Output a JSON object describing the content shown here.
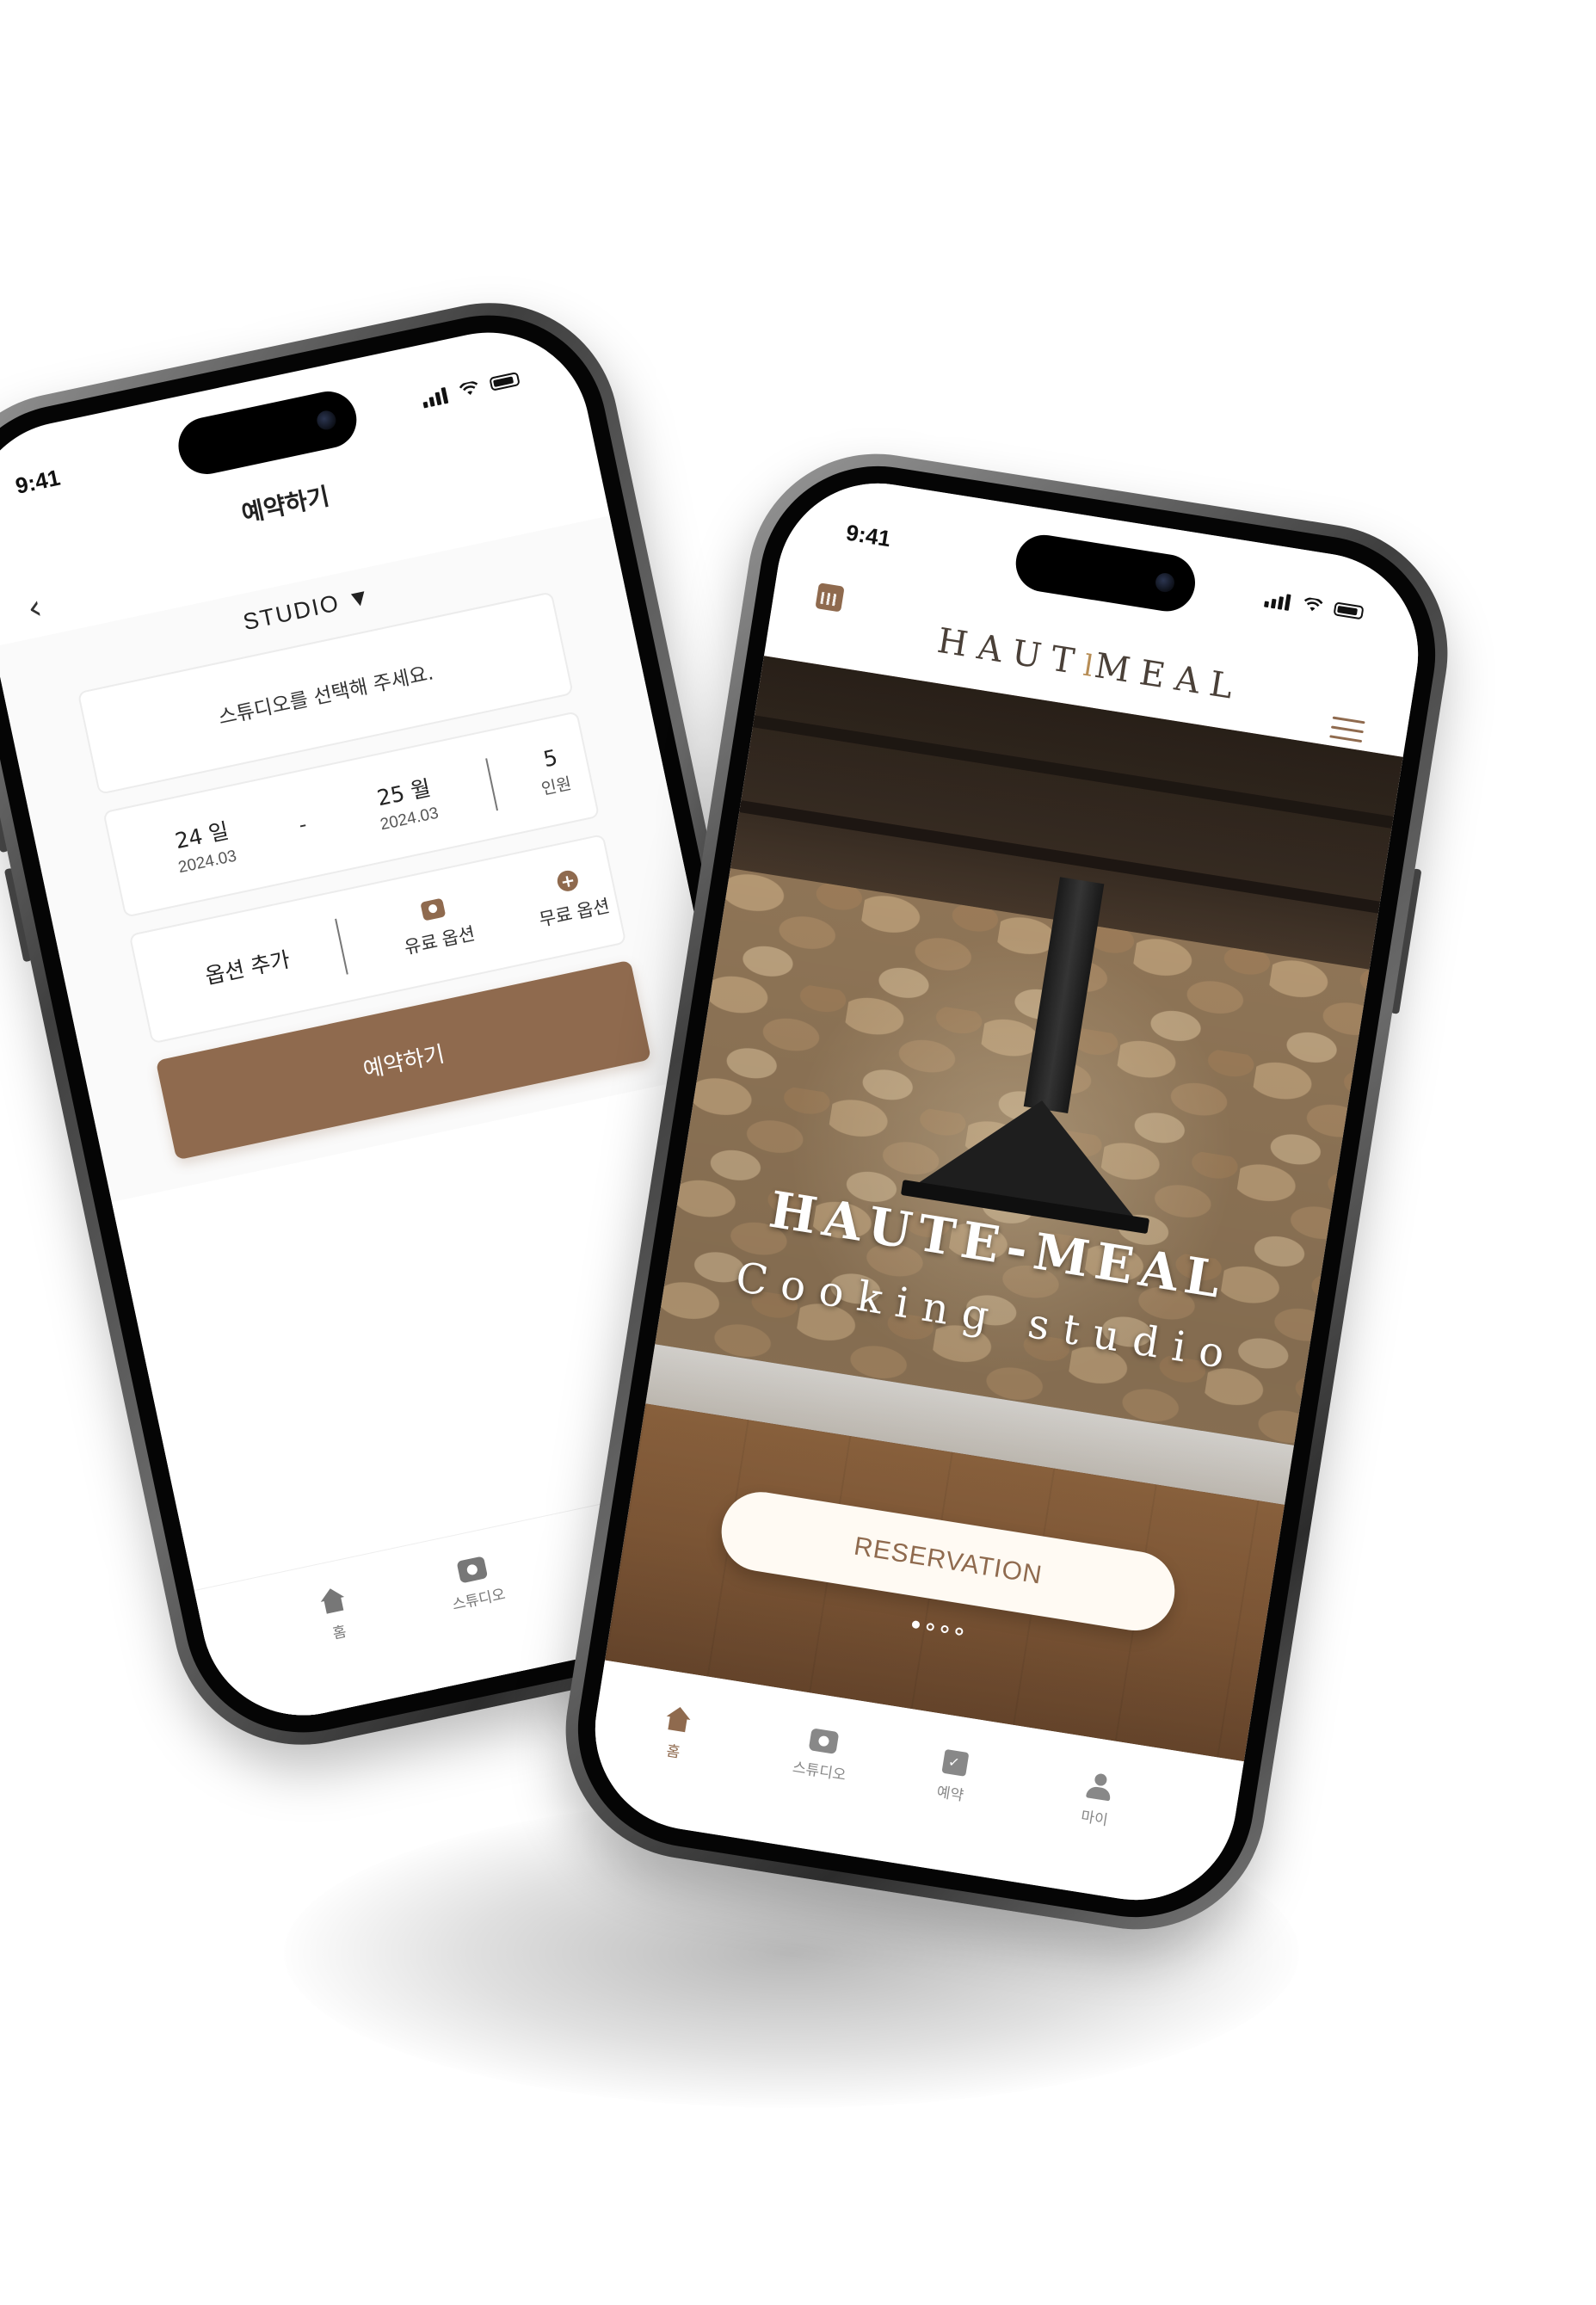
{
  "status_bar": {
    "time": "9:41"
  },
  "booking_screen": {
    "title": "예약하기",
    "back_icon": "chevron-left-icon",
    "studio_label": "STUDIO ▼",
    "studio_placeholder": "스튜디오를 선택해 주세요.",
    "check_in": {
      "day": "24 일",
      "month": "2024.03"
    },
    "separator": "-",
    "check_out": {
      "day": "25 월",
      "month": "2024.03"
    },
    "guests": {
      "count": "5",
      "label": "인원"
    },
    "options": {
      "label": "옵션 추가",
      "paid": "유료 옵션",
      "free": "무료 옵션"
    },
    "submit_label": "예약하기",
    "tabs": [
      {
        "label": "홈",
        "icon": "home-icon"
      },
      {
        "label": "스튜디오",
        "icon": "camera-icon"
      }
    ]
  },
  "home_screen": {
    "logo_left": "HAUT",
    "logo_right": "MEAL",
    "hero_title": "HAUTE-MEAL",
    "hero_subtitle": "Cooking studio",
    "reserve_label": "RESERVATION",
    "carousel": {
      "count": 4,
      "active": 0
    },
    "tabs": [
      {
        "label": "홈",
        "icon": "home-icon",
        "active": true
      },
      {
        "label": "스튜디오",
        "icon": "camera-icon"
      },
      {
        "label": "예약",
        "icon": "calendar-check-icon"
      },
      {
        "label": "마이",
        "icon": "user-icon"
      }
    ]
  },
  "colors": {
    "accent": "#8f6a4e",
    "text": "#222222",
    "background": "#ffffff"
  }
}
